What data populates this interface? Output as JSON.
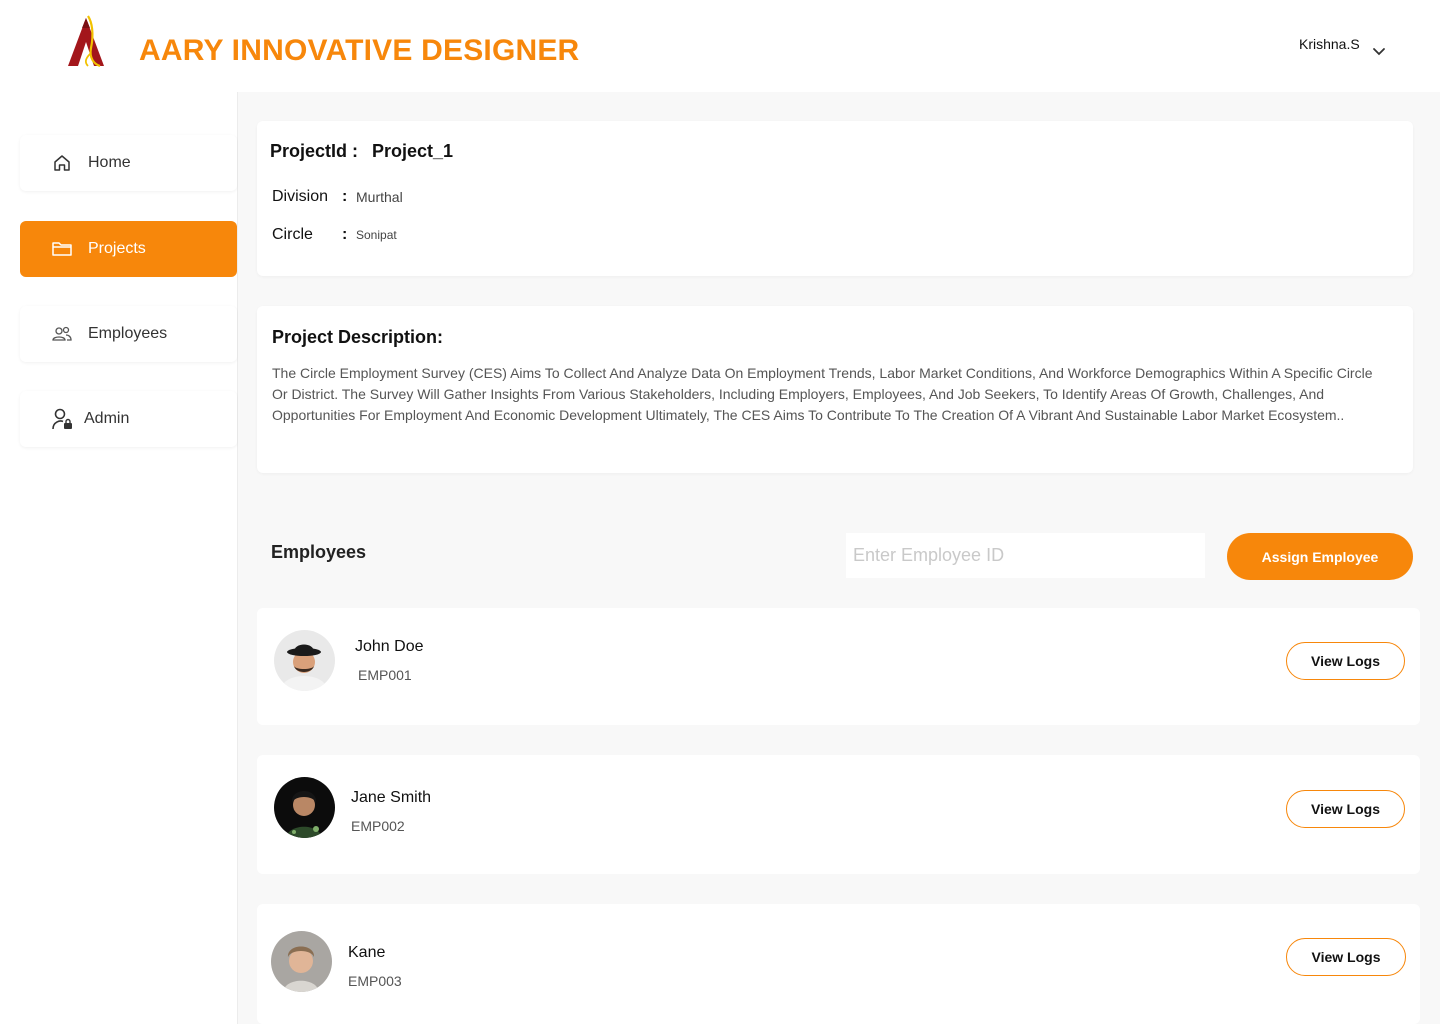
{
  "header": {
    "brand": "AARY INNOVATIVE DESIGNER",
    "user_name": "Krishna.S"
  },
  "sidebar": {
    "items": [
      {
        "label": "Home",
        "icon": "home-icon",
        "active": false
      },
      {
        "label": "Projects",
        "icon": "folder-icon",
        "active": true
      },
      {
        "label": "Employees",
        "icon": "users-icon",
        "active": false
      },
      {
        "label": "Admin",
        "icon": "admin-user-lock-icon",
        "active": false
      }
    ]
  },
  "project": {
    "id_label": "ProjectId :",
    "id_value": "Project_1",
    "division_label": "Division",
    "division_value": "Murthal",
    "circle_label": "Circle",
    "circle_value": "Sonipat",
    "colon": ":"
  },
  "description": {
    "title": "Project Description:",
    "text": "The Circle Employment Survey (CES) Aims To Collect And Analyze Data On Employment Trends, Labor Market Conditions, And Workforce Demographics Within A Specific Circle Or District. The Survey Will Gather Insights From Various Stakeholders, Including Employers, Employees, And Job Seekers, To Identify Areas Of Growth, Challenges, And Opportunities For Employment And Economic Development Ultimately, The CES Aims To Contribute To The Creation Of A Vibrant And Sustainable Labor Market Ecosystem.."
  },
  "employees_section": {
    "title": "Employees",
    "input_placeholder": "Enter Employee ID",
    "assign_label": "Assign Employee",
    "view_logs_label": "View Logs",
    "list": [
      {
        "name": "John Doe",
        "id": "EMP001"
      },
      {
        "name": "Jane Smith",
        "id": "EMP002"
      },
      {
        "name": "Kane",
        "id": "EMP003"
      }
    ]
  },
  "colors": {
    "accent": "#f7870b",
    "background": "#f8f8f8",
    "card": "#ffffff"
  }
}
